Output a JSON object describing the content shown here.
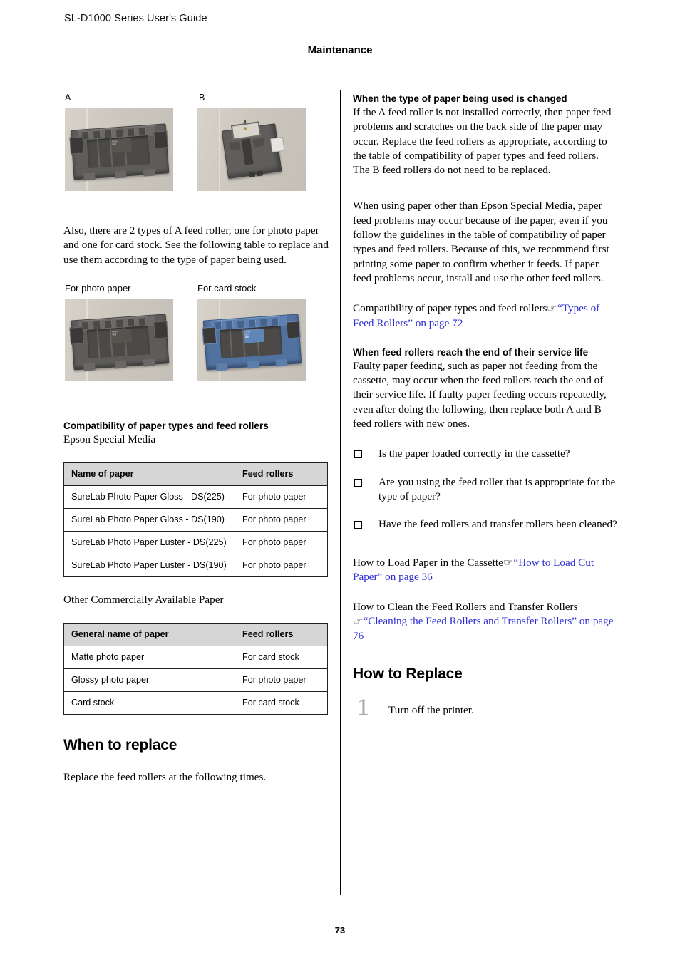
{
  "header": {
    "doc_title": "SL-D1000 Series User's Guide",
    "chapter": "Maintenance"
  },
  "footer": {
    "page_number": "73"
  },
  "left_column": {
    "figure_ab": {
      "label_a": "A",
      "label_b": "B"
    },
    "intro_paragraph": "Also, there are 2 types of A feed roller, one for photo paper and one for card stock. See the following table to replace and use them according to the type of paper being used.",
    "figure_types": {
      "caption_left": "For photo paper",
      "caption_right": "For card stock"
    },
    "compat_heading": "Compatibility of paper types and feed rollers",
    "epson_media_label": "Epson Special Media",
    "table_epson": {
      "headers": [
        "Name of paper",
        "Feed rollers"
      ],
      "rows": [
        [
          "SureLab Photo Paper Gloss - DS(225)",
          "For photo paper"
        ],
        [
          "SureLab Photo Paper Gloss - DS(190)",
          "For photo paper"
        ],
        [
          "SureLab Photo Paper Luster - DS(225)",
          "For photo paper"
        ],
        [
          "SureLab Photo Paper Luster - DS(190)",
          "For photo paper"
        ]
      ]
    },
    "other_paper_label": "Other Commercially Available Paper",
    "table_other": {
      "headers": [
        "General name of paper",
        "Feed rollers"
      ],
      "rows": [
        [
          "Matte photo paper",
          "For card stock"
        ],
        [
          "Glossy photo paper",
          "For photo paper"
        ],
        [
          "Card stock",
          "For card stock"
        ]
      ]
    },
    "when_to_replace_heading": "When to replace",
    "when_to_replace_text": "Replace the feed rollers at the following times."
  },
  "right_column": {
    "section_paper_changed": {
      "heading": "When the type of paper being used is changed",
      "paragraph_1": "If the A feed roller is not installed correctly, then paper feed problems and scratches on the back side of the paper may occur. Replace the feed rollers as appropriate, according to the table of compatibility of paper types and feed rollers. The B feed rollers do not need to be replaced.",
      "paragraph_2": "When using paper other than Epson Special Media, paper feed problems may occur because of the paper, even if you follow the guidelines in the table of compatibility of paper types and feed rollers. Because of this, we recommend first printing some paper to confirm whether it feeds. If paper feed problems occur, install and use the other feed rollers.",
      "xref_lead": "Compatibility of paper types and feed rollers",
      "xref_icon": "pointing-hand-icon",
      "xref_link": "“Types of Feed Rollers” on page 72"
    },
    "section_service_life": {
      "heading": "When feed rollers reach the end of their service life",
      "paragraph": "Faulty paper feeding, such as paper not feeding from the cassette, may occur when the feed rollers reach the end of their service life. If faulty paper feeding occurs repeatedly, even after doing the following, then replace both A and B feed rollers with new ones.",
      "checklist": [
        "Is the paper loaded correctly in the cassette?",
        "Are you using the feed roller that is appropriate for the type of paper?",
        "Have the feed rollers and transfer rollers been cleaned?"
      ],
      "xref_load_lead": "How to Load Paper in the Cassette",
      "xref_load_link": "“How to Load Cut Paper” on page 36",
      "xref_clean_lead": "How to Clean the Feed Rollers and Transfer Rollers",
      "xref_clean_link": "“Cleaning the Feed Rollers and Transfer Rollers” on page 76"
    },
    "section_how_to_replace": {
      "heading": "How to Replace",
      "step_1_number": "1",
      "step_1_text": "Turn off the printer."
    }
  },
  "colors": {
    "link": "#2e2ed6",
    "table_header_bg": "#d6d6d6",
    "step_number": "#a6a6a6",
    "roller_photo_gray": "#5d5c5a",
    "roller_card_blue": "#51719f"
  }
}
